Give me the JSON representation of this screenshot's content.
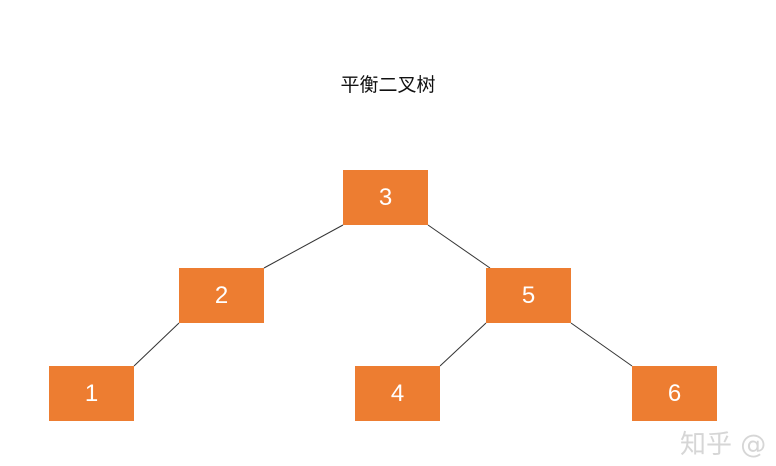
{
  "diagram": {
    "title": "平衡二叉树",
    "node_color": "#ED7D31",
    "edge_color": "#333333",
    "nodes": [
      {
        "id": "n3",
        "label": "3"
      },
      {
        "id": "n2",
        "label": "2"
      },
      {
        "id": "n5",
        "label": "5"
      },
      {
        "id": "n1",
        "label": "1"
      },
      {
        "id": "n4",
        "label": "4"
      },
      {
        "id": "n6",
        "label": "6"
      }
    ],
    "edges": [
      {
        "from": "n3",
        "to": "n2"
      },
      {
        "from": "n3",
        "to": "n5"
      },
      {
        "from": "n2",
        "to": "n1"
      },
      {
        "from": "n5",
        "to": "n4"
      },
      {
        "from": "n5",
        "to": "n6"
      }
    ]
  },
  "watermark": {
    "text": "知乎 @"
  }
}
